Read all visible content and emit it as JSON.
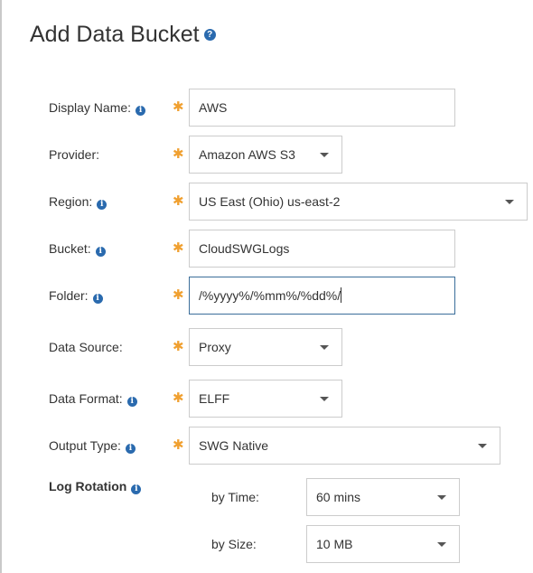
{
  "title": "Add Data Bucket",
  "help_glyph": "?",
  "info_glyph": "i",
  "required_mark": "✱",
  "fields": {
    "display_name": {
      "label": "Display Name:",
      "value": "AWS"
    },
    "provider": {
      "label": "Provider:",
      "value": "Amazon AWS S3"
    },
    "region": {
      "label": "Region:",
      "value": "US East (Ohio) us-east-2"
    },
    "bucket": {
      "label": "Bucket:",
      "value": "CloudSWGLogs"
    },
    "folder": {
      "label": "Folder:",
      "value": "/%yyyy%/%mm%/%dd%/"
    },
    "data_source": {
      "label": "Data Source:",
      "value": "Proxy"
    },
    "data_format": {
      "label": "Data Format:",
      "value": "ELFF"
    },
    "output_type": {
      "label": "Output Type:",
      "value": "SWG Native"
    }
  },
  "log_rotation": {
    "label": "Log Rotation",
    "by_time": {
      "label": "by Time:",
      "value": "60 mins"
    },
    "by_size": {
      "label": "by Size:",
      "value": "10 MB"
    }
  },
  "colors": {
    "required": "#f0a030",
    "info": "#2a6aae",
    "focus_border": "#3b6e9a"
  }
}
